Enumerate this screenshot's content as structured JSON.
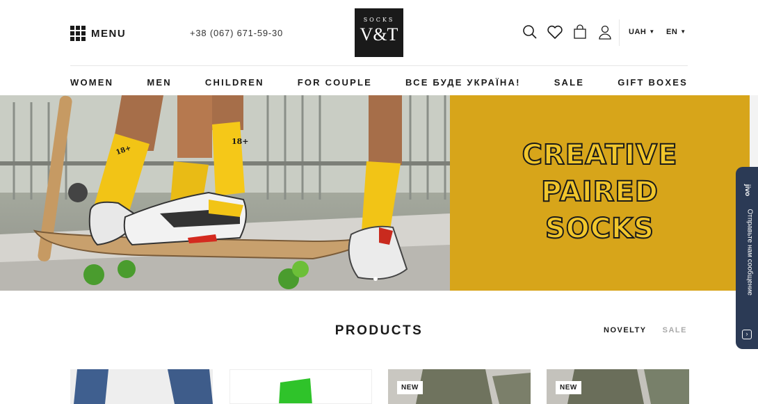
{
  "header": {
    "menu_label": "MENU",
    "phone": "+38 (067) 671-59-30",
    "logo_top": "SOCKS",
    "logo_main": "V&T",
    "currency": "UAH",
    "language": "EN",
    "icons": [
      "search-icon",
      "heart-icon",
      "bag-icon",
      "user-icon"
    ]
  },
  "nav": {
    "items": [
      "WOMEN",
      "MEN",
      "CHILDREN",
      "FOR COUPLE",
      "ВСЕ БУДЕ УКРАЇНА!",
      "SALE",
      "GIFT BOXES"
    ]
  },
  "hero": {
    "lines": [
      "CREATIVE",
      "PAIRED",
      "SOCKS"
    ],
    "sock_print": "18+",
    "accent_color": "#d7a51a"
  },
  "chat": {
    "brand": "jivo",
    "text": "Отправьте нам сообщение"
  },
  "products": {
    "title": "PRODUCTS",
    "tabs": [
      "NOVELTY",
      "SALE"
    ],
    "cards": [
      {
        "badge": ""
      },
      {
        "badge": ""
      },
      {
        "badge": "NEW"
      },
      {
        "badge": "NEW"
      }
    ]
  }
}
